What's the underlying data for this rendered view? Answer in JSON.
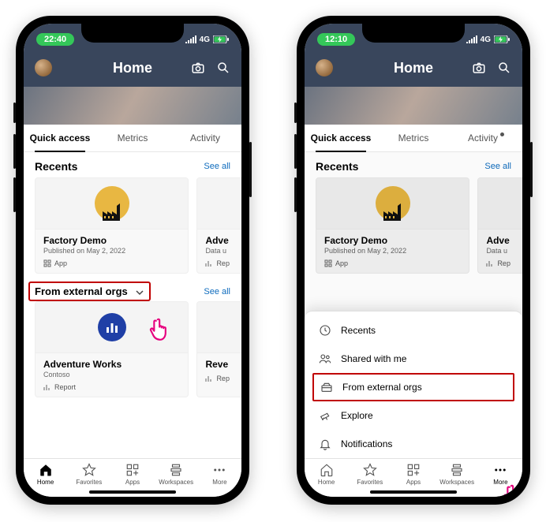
{
  "left": {
    "status": {
      "time": "22:40",
      "net": "4G"
    },
    "header": {
      "title": "Home"
    },
    "tabs": {
      "t0": "Quick access",
      "t1": "Metrics",
      "t2": "Activity"
    },
    "recents": {
      "title": "Recents",
      "see_all": "See all",
      "card0": {
        "title": "Factory Demo",
        "sub": "Published on May 2, 2022",
        "type": "App"
      },
      "card1": {
        "title": "Adve",
        "sub": "Data u",
        "type": "Rep"
      }
    },
    "external": {
      "title": "From external orgs",
      "see_all": "See all",
      "card0": {
        "title": "Adventure Works",
        "sub": "Contoso",
        "type": "Report"
      },
      "card1": {
        "title": "Reve",
        "sub": "",
        "type": "Rep"
      }
    },
    "nav": {
      "n0": "Home",
      "n1": "Favorites",
      "n2": "Apps",
      "n3": "Workspaces",
      "n4": "More"
    }
  },
  "right": {
    "status": {
      "time": "12:10",
      "net": "4G"
    },
    "header": {
      "title": "Home"
    },
    "tabs": {
      "t0": "Quick access",
      "t1": "Metrics",
      "t2": "Activity"
    },
    "recents": {
      "title": "Recents",
      "see_all": "See all",
      "card0": {
        "title": "Factory Demo",
        "sub": "Published on May 2, 2022",
        "type": "App"
      },
      "card1": {
        "title": "Adve",
        "sub": "Data u",
        "type": "Rep"
      }
    },
    "sheet": {
      "s0": "Recents",
      "s1": "Shared with me",
      "s2": "From external orgs",
      "s3": "Explore",
      "s4": "Notifications"
    },
    "nav": {
      "n0": "Home",
      "n1": "Favorites",
      "n2": "Apps",
      "n3": "Workspaces",
      "n4": "More"
    }
  }
}
